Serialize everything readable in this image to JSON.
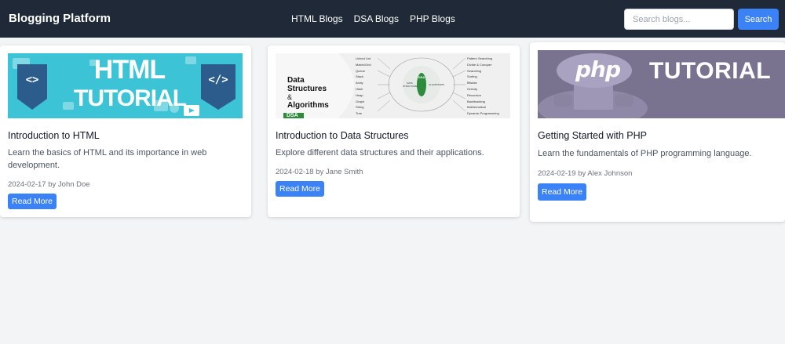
{
  "header": {
    "brand": "Blogging Platform",
    "nav": [
      "HTML Blogs",
      "DSA Blogs",
      "PHP Blogs"
    ],
    "search_placeholder": "Search blogs...",
    "search_label": "Search"
  },
  "cards": [
    {
      "image": {
        "title_line1": "HTML",
        "title_line2": "TUTORIAL",
        "left_badge": "<>",
        "right_badge": "</>"
      },
      "title": "Introduction to HTML",
      "description": "Learn the basics of HTML and its importance in web development.",
      "meta": "2024-02-17 by John Doe",
      "button": "Read More"
    },
    {
      "image": {
        "line1": "Data",
        "line2": "Structures",
        "line3": "&",
        "line4": "Algorithms",
        "tag": "DSA",
        "hub_left": "DATA STRUCTURE",
        "hub_right": "ALGORITHMS",
        "hub_center": "DSA",
        "left_items": [
          "Linked List",
          "Matrix/Grid",
          "Queue",
          "Stack",
          "Array",
          "Hash",
          "Heap",
          "Graph",
          "String",
          "Tree"
        ],
        "right_items": [
          "Pattern Searching",
          "Divide & Conquer",
          "Searching",
          "Sorting",
          "Bitwise",
          "Greedy",
          "Recursion",
          "Backtracking",
          "Mathematical",
          "Dynamic Programming"
        ]
      },
      "title": "Introduction to Data Structures",
      "description": "Explore different data structures and their applications.",
      "meta": "2024-02-18 by Jane Smith",
      "button": "Read More"
    },
    {
      "image": {
        "logo": "php",
        "word": "TUTORIAL"
      },
      "title": "Getting Started with PHP",
      "description": "Learn the fundamentals of PHP programming language.",
      "meta": "2024-02-19 by Alex Johnson",
      "button": "Read More"
    }
  ],
  "colors": {
    "navbar": "#1f2937",
    "accent": "#3b82f6",
    "background": "#f3f4f6"
  }
}
